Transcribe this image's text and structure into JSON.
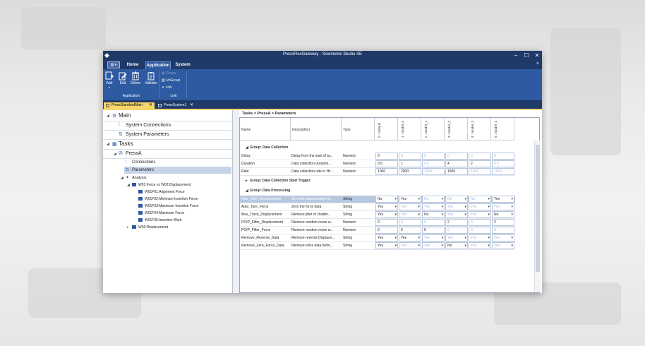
{
  "window": {
    "title": "PressFlexGateway - Sciemetric Studio SE",
    "min": "−",
    "max": "☐",
    "close": "✕"
  },
  "menu": {
    "qat": "▤ ▾",
    "tabs": [
      {
        "label": "Home"
      },
      {
        "label": "Application"
      },
      {
        "label": "System"
      }
    ],
    "collapse": "˄"
  },
  "ribbon": {
    "buttons": [
      {
        "label": "Add",
        "sub": "▾"
      },
      {
        "label": "Edit"
      },
      {
        "label": "Delete"
      },
      {
        "label": "Validate"
      }
    ],
    "group_app_label": "Application",
    "link_items": [
      {
        "label": "Group"
      },
      {
        "label": "UnGroup"
      },
      {
        "label": "Link"
      },
      {
        "label": "Unlink"
      }
    ],
    "group_link_label": "Link"
  },
  "doc_tabs": [
    {
      "label": "PressStandardMain",
      "close": "✕"
    },
    {
      "label": "PressSystem1",
      "close": "✕"
    }
  ],
  "tree": {
    "main": "Main",
    "system_connections": "System Connections",
    "system_parameters": "System Parameters",
    "tasks": "Tasks",
    "pressa": "PressA",
    "connections": "Connections",
    "parameters": "Parameters",
    "analysis": "Analysis",
    "w01": "W01:Force vs W02:Displacement",
    "w01f01": "W01F01:Alignment Force",
    "w01f02": "W01F02:Minimum Insertion Force",
    "w01f03": "W01F03:Maximum Insertion Force",
    "w01f04": "W01F04:Maximum Force",
    "w01f05": "W01F05:Insertion Work",
    "w02": "W02:Displacement"
  },
  "breadcrumb": "Tasks > PressA > Parameters",
  "grid": {
    "headers": {
      "name": "Name",
      "description": "Description",
      "type": "Type"
    },
    "value_columns": [
      "0 : Default",
      "1 : Model_0",
      "2 : Model_1",
      "3 : Model_2",
      "4 : Model_3",
      "5 : Model_4"
    ],
    "groups": {
      "g1": "Group: Data Collection",
      "g2": "Group: Data Collection Start Trigger",
      "g3": "Group: Data Processing"
    },
    "rows": {
      "r0": {
        "name": "Delay",
        "description": "Delay from the start of ta...",
        "type": "Numeric",
        "v": [
          "0",
          "0",
          "0",
          "0",
          "0",
          "0"
        ]
      },
      "r1": {
        "name": "Duration",
        "description": "Data collection duration...",
        "type": "Numeric",
        "v": [
          "0.5",
          "1",
          "0.5",
          "4",
          "2",
          "0.5"
        ]
      },
      "r2": {
        "name": "Rate",
        "description": "Data collection rate in Hz...",
        "type": "Numeric",
        "v": [
          "1000",
          "2000",
          "1000",
          "1500",
          "1000",
          "1000"
        ]
      },
      "r3": {
        "name": "Auto_Tare_Displacement",
        "description": "Zero the displacement d...",
        "type": "String",
        "v": [
          "No",
          "Yes",
          "No",
          "No",
          "No",
          "Yes"
        ]
      },
      "r4": {
        "name": "Auto_Tare_Force",
        "description": "Zero the force data",
        "type": "String",
        "v": [
          "Yes",
          "Yes",
          "Yes",
          "Yes",
          "Yes",
          "Yes"
        ]
      },
      "r5": {
        "name": "Max_Track_Displacement",
        "description": "Remove jitter or chatter...",
        "type": "String",
        "v": [
          "Yes",
          "Yes",
          "No",
          "Yes",
          "Yes",
          "No"
        ]
      },
      "r6": {
        "name": "POIP_Filter_Displacement",
        "description": "Remove random noise w...",
        "type": "Numeric",
        "v": [
          "0",
          "0",
          "0",
          "2",
          "0",
          "2"
        ]
      },
      "r7": {
        "name": "POIP_Filter_Force",
        "description": "Remove random noise w...",
        "type": "Numeric",
        "v": [
          "0",
          "6",
          "6",
          "0",
          "0",
          "0"
        ]
      },
      "r8": {
        "name": "Remove_Reverse_Data",
        "description": "Remove reverse Displace...",
        "type": "String",
        "v": [
          "Yes",
          "Yes",
          "Yes",
          "Yes",
          "Yes",
          "Yes"
        ]
      },
      "r9": {
        "name": "Remove_Zero_Force_Data",
        "description": "Remove extra data befor...",
        "type": "String",
        "v": [
          "Yes",
          "Yes",
          "Yes",
          "No",
          "Yes",
          "Yes"
        ]
      }
    }
  },
  "colors": {
    "title_bar": "#1f3a68",
    "ribbon": "#2d5aa0",
    "active_tab": "#f6d66b",
    "selected_row": "#b7c7e0",
    "inherited_value": "#9fb7dc"
  }
}
